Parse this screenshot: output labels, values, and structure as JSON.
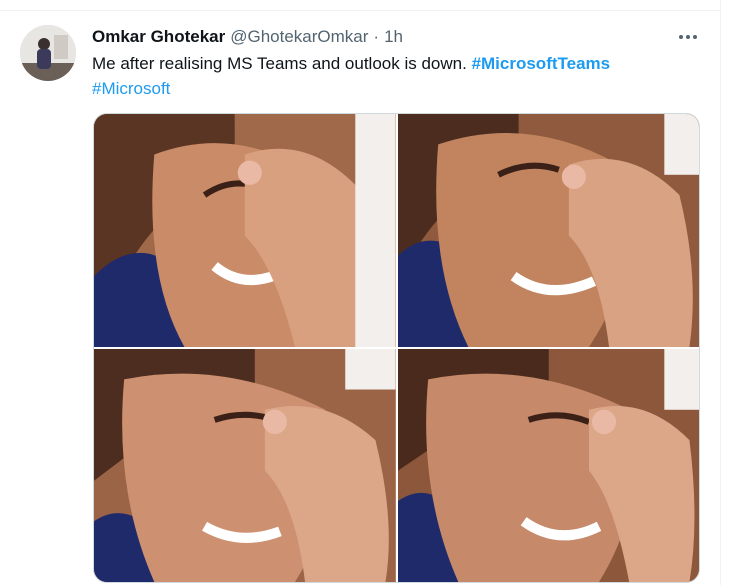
{
  "tweet": {
    "author_name": "Omkar Ghotekar",
    "handle": "@GhotekarOmkar",
    "separator": "·",
    "timestamp": "1h",
    "text_before": "Me after realising MS Teams and outlook is down.",
    "hashtags": [
      "#MicrosoftTeams",
      "#Microsoft"
    ],
    "more_icon": "more-horizontal-icon"
  },
  "media": {
    "images": [
      {
        "name": "photo-top-left"
      },
      {
        "name": "photo-top-right"
      },
      {
        "name": "photo-bottom-left"
      },
      {
        "name": "photo-bottom-right"
      }
    ]
  },
  "colors": {
    "hashtag": "#1d9bf0",
    "secondary_text": "#536471",
    "primary_text": "#0f1419",
    "border": "#cfd9de"
  }
}
